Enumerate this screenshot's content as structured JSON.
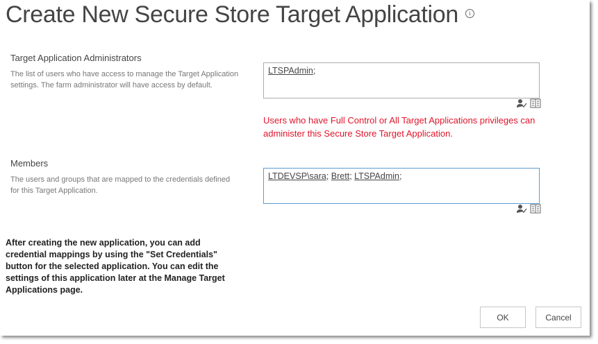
{
  "title": "Create New Secure Store Target Application",
  "admins": {
    "label": "Target Application Administrators",
    "description": "The list of users who have access to manage the Target Application settings. The farm administrator will have access by default.",
    "entries": [
      "LTSPAdmin"
    ]
  },
  "warning": "Users who have Full Control or All Target Applications privileges can administer this Secure Store Target Application.",
  "members": {
    "label": "Members",
    "description": "The users and groups that are mapped to the credentials defined for this Target Application.",
    "entries": [
      "LTDEVSP\\sara",
      "Brett",
      "LTSPAdmin"
    ]
  },
  "note": "After creating the new application, you can add credential mappings by using the \"Set Credentials\" button for the selected application. You can edit the settings of this application later at the Manage Target Applications page.",
  "buttons": {
    "ok": "OK",
    "cancel": "Cancel"
  },
  "colors": {
    "warning": "#e0142a",
    "focus": "#5b9bd5"
  }
}
